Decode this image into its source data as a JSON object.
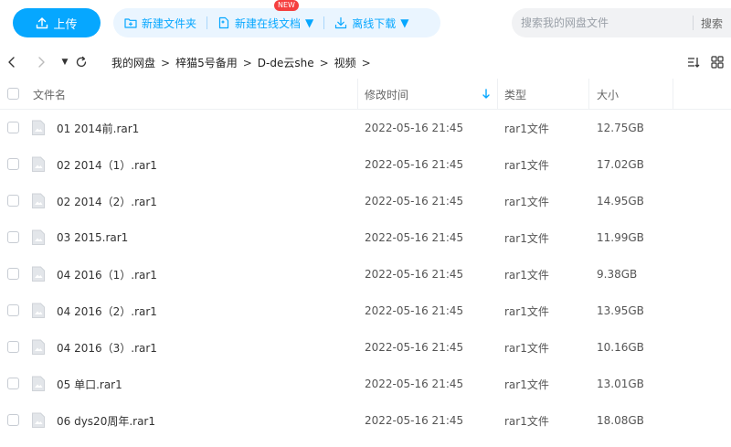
{
  "toolbar": {
    "upload_label": "上传",
    "new_folder_label": "新建文件夹",
    "new_doc_label": "新建在线文档",
    "new_badge": "NEW",
    "offline_download_label": "离线下载",
    "search_placeholder": "搜索我的网盘文件",
    "search_button_label": "搜索"
  },
  "breadcrumb": [
    "我的网盘",
    "梓猫5号备用",
    "D-de云she",
    "视频"
  ],
  "breadcrumb_separator": ">",
  "table": {
    "columns": {
      "name": "文件名",
      "modified": "修改时间",
      "type": "类型",
      "size": "大小"
    },
    "rows": [
      {
        "name": "01 2014前.rar1",
        "modified": "2022-05-16 21:45",
        "type": "rar1文件",
        "size": "12.75GB"
      },
      {
        "name": "02 2014（1）.rar1",
        "modified": "2022-05-16 21:45",
        "type": "rar1文件",
        "size": "17.02GB"
      },
      {
        "name": "02 2014（2）.rar1",
        "modified": "2022-05-16 21:45",
        "type": "rar1文件",
        "size": "14.95GB"
      },
      {
        "name": "03  2015.rar1",
        "modified": "2022-05-16 21:45",
        "type": "rar1文件",
        "size": "11.99GB"
      },
      {
        "name": "04 2016（1）.rar1",
        "modified": "2022-05-16 21:45",
        "type": "rar1文件",
        "size": "9.38GB"
      },
      {
        "name": "04 2016（2）.rar1",
        "modified": "2022-05-16 21:45",
        "type": "rar1文件",
        "size": "13.95GB"
      },
      {
        "name": "04 2016（3）.rar1",
        "modified": "2022-05-16 21:45",
        "type": "rar1文件",
        "size": "10.16GB"
      },
      {
        "name": "05 单口.rar1",
        "modified": "2022-05-16 21:45",
        "type": "rar1文件",
        "size": "13.01GB"
      },
      {
        "name": "06 dys20周年.rar1",
        "modified": "2022-05-16 21:45",
        "type": "rar1文件",
        "size": "18.08GB"
      }
    ]
  },
  "colors": {
    "accent": "#06a7ff",
    "accent_light": "#eaf5ff",
    "badge": "#f53f3f"
  },
  "icons": [
    "upload-icon",
    "new-folder-icon",
    "new-doc-icon",
    "download-icon",
    "back-icon",
    "forward-icon",
    "history-dropdown-icon",
    "refresh-icon",
    "sort-icon",
    "grid-view-icon",
    "file-icon"
  ]
}
